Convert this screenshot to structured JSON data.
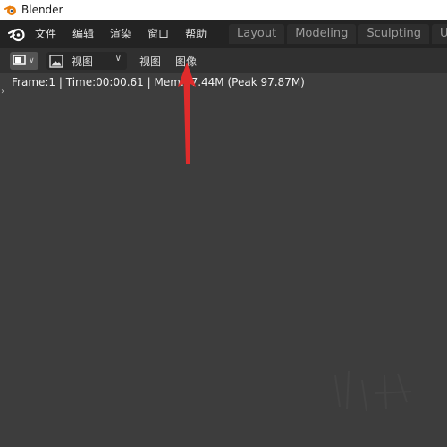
{
  "window": {
    "title": "Blender",
    "icon": "blender-icon"
  },
  "menubar": {
    "logo": "blender-logo-icon",
    "items": [
      "文件",
      "编辑",
      "渲染",
      "窗口",
      "帮助"
    ]
  },
  "workspace_tabs": [
    "Layout",
    "Modeling",
    "Sculpting",
    "UV"
  ],
  "header": {
    "editor_type_icon": "image-editor-icon",
    "view_select": {
      "icon": "image-icon",
      "label": "视图"
    },
    "menus": [
      "视图",
      "图像"
    ]
  },
  "info": {
    "text": "Frame:1 | Time:00:00.61 | Mem:97.44M (Peak 97.87M)"
  },
  "colors": {
    "menubar_bg": "#232323",
    "header_bg": "#303030",
    "viewport_bg": "#3d3d3d",
    "annotation_arrow": "#e02b2b"
  }
}
